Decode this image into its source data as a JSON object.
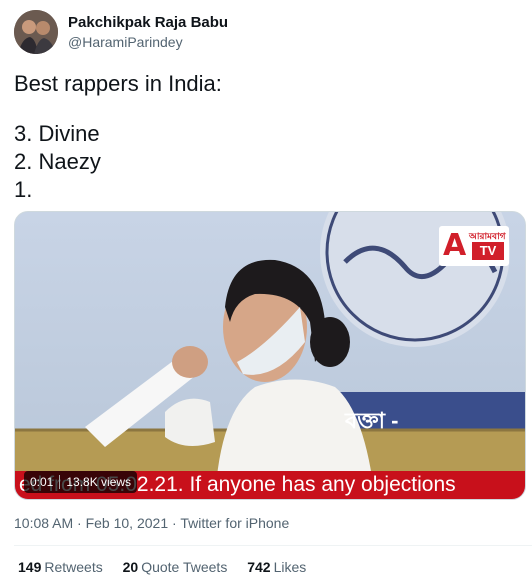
{
  "author": {
    "display_name": "Pakchikpak Raja Babu",
    "handle": "@HaramiParindey"
  },
  "tweet": {
    "text_lines": [
      "Best rappers in India:",
      "3. Divine",
      "2. Naezy",
      "1."
    ],
    "timestamp": "10:08 AM · Feb 10, 2021",
    "separator": " · ",
    "source": "Twitter for iPhone"
  },
  "video": {
    "duration": "0:01",
    "views": "13.8K views",
    "ticker_text": "ed from 05.02.21. If anyone has any objections",
    "channel_logo": {
      "letter": "A",
      "top_text": "আরামবাগ",
      "tv": "TV"
    },
    "banner_text": "বক্তা -"
  },
  "stats": [
    {
      "count": "149",
      "label": "Retweets"
    },
    {
      "count": "20",
      "label": "Quote Tweets"
    },
    {
      "count": "742",
      "label": "Likes"
    }
  ],
  "colors": {
    "text": "#0f1419",
    "secondary": "#536471",
    "ticker_red": "#c8101b"
  }
}
